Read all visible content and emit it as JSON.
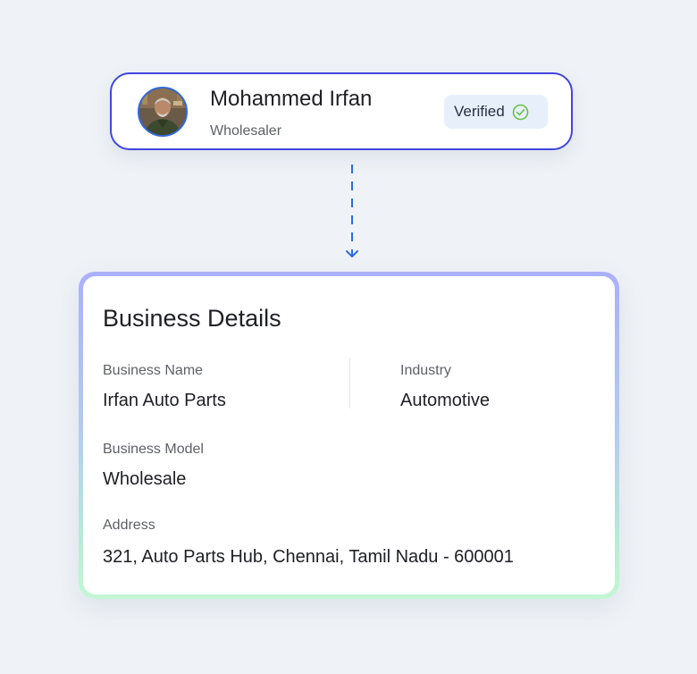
{
  "profile": {
    "name": "Mohammed Irfan",
    "role": "Wholesaler",
    "verified_label": "Verified",
    "accent_color": "#4046e0",
    "check_color": "#6cc04a"
  },
  "business": {
    "title": "Business Details",
    "fields": {
      "business_name": {
        "label": "Business Name",
        "value": "Irfan Auto Parts"
      },
      "industry": {
        "label": "Industry",
        "value": "Automotive"
      },
      "business_model": {
        "label": "Business Model",
        "value": "Wholesale"
      },
      "address": {
        "label": "Address",
        "value": "321, Auto Parts Hub, Chennai, Tamil Nadu - 600001"
      }
    }
  },
  "icons": {
    "avatar": "avatar-photo",
    "verified": "check-circle-icon",
    "connector": "dashed-arrow-down-icon"
  }
}
